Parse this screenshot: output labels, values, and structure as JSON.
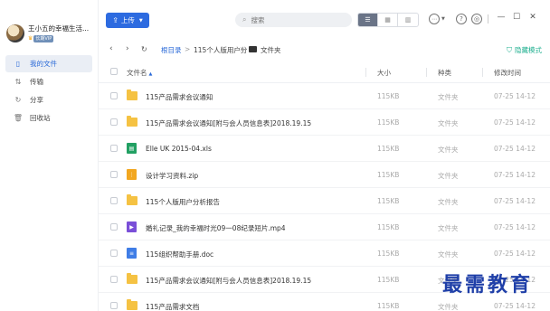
{
  "user": {
    "name": "王小五的幸福生活...",
    "vip_label": "长期VIP"
  },
  "sidebar": {
    "items": [
      {
        "label": "我的文件",
        "icon": "document-icon",
        "active": true
      },
      {
        "label": "传输",
        "icon": "transfer-icon",
        "active": false
      },
      {
        "label": "分享",
        "icon": "share-icon",
        "active": false
      },
      {
        "label": "回收站",
        "icon": "trash-icon",
        "active": false
      }
    ]
  },
  "toolbar": {
    "upload_label": "上传",
    "search_placeholder": "搜索"
  },
  "breadcrumb": {
    "root": "根目录",
    "sep": ">",
    "items": [
      "115个人版用户分",
      "文件夹"
    ]
  },
  "hidden_mode_label": "隐藏模式",
  "table": {
    "headers": {
      "name": "文件名",
      "size": "大小",
      "type": "种类",
      "time": "修改时间"
    },
    "rows": [
      {
        "name": "115产品需求会议通知",
        "size": "115KB",
        "type": "文件夹",
        "time": "07-25 14-12",
        "icon": "folder"
      },
      {
        "name": "115产品需求会议通知[附与会人员信息表]2018.19.15",
        "size": "115KB",
        "type": "文件夹",
        "time": "07-25 14-12",
        "icon": "folder"
      },
      {
        "name": "Elle UK 2015-04.xls",
        "size": "115KB",
        "type": "文件夹",
        "time": "07-25 14-12",
        "icon": "xls"
      },
      {
        "name": "设计学习资料.zip",
        "size": "115KB",
        "type": "文件夹",
        "time": "07-25 14-12",
        "icon": "zip"
      },
      {
        "name": "115个人版用户分析报告",
        "size": "115KB",
        "type": "文件夹",
        "time": "07-25 14-12",
        "icon": "folder"
      },
      {
        "name": "婚礼记录_我的幸福时光09一08纪录短片.mp4",
        "size": "115KB",
        "type": "文件夹",
        "time": "07-25 14-12",
        "icon": "video"
      },
      {
        "name": "115组织帮助手册.doc",
        "size": "115KB",
        "type": "文件夹",
        "time": "07-25 14-12",
        "icon": "doc"
      },
      {
        "name": "115产品需求会议通知[附与会人员信息表]2018.19.15",
        "size": "115KB",
        "type": "文件夹",
        "time": "07-25 14-12",
        "icon": "folder"
      },
      {
        "name": "115产品需求文档",
        "size": "115KB",
        "type": "文件夹",
        "time": "07-25 14-12",
        "icon": "folder"
      }
    ]
  },
  "watermark": "最需教育"
}
